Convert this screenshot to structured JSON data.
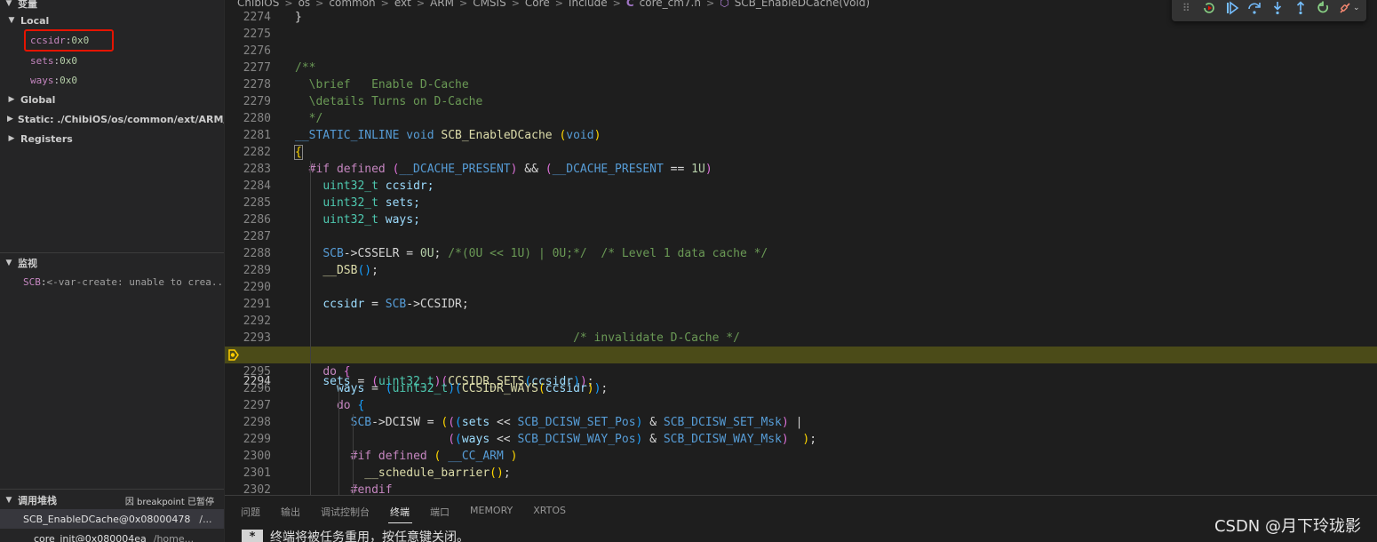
{
  "sidebar": {
    "variables_header": "变量",
    "local_label": "Local",
    "locals": [
      {
        "name": "ccsidr",
        "value": "0x0"
      },
      {
        "name": "sets",
        "value": "0x0"
      },
      {
        "name": "ways",
        "value": "0x0"
      }
    ],
    "scopes": [
      "Global",
      "Static: ./ChibiOS/os/common/ext/ARM/CMSIS",
      "Registers"
    ],
    "watch_header": "监视",
    "watch_items": [
      {
        "name": "SCB",
        "value": "<-var-create: unable to crea..."
      }
    ],
    "callstack_header": "调用堆栈",
    "callstack_status": "因 breakpoint 已暂停",
    "frames": [
      {
        "name": "SCB_EnableDCache@0x08000478",
        "path": "/..."
      },
      {
        "name": "core_init@0x080004ea",
        "path": "/home..."
      }
    ]
  },
  "breadcrumb": {
    "items": [
      "ChibiOS",
      "os",
      "common",
      "ext",
      "ARM",
      "CMSIS",
      "Core",
      "Include"
    ],
    "file": "core_cm7.h",
    "symbol": "SCB_EnableDCache(void)"
  },
  "debug_toolbar": {
    "buttons": [
      "drag-handle",
      "continue",
      "step-over",
      "step-into",
      "step-out",
      "restart",
      "disconnect"
    ]
  },
  "editor": {
    "current_line": 2294,
    "line_numbers": [
      2274,
      2275,
      2276,
      2277,
      2278,
      2279,
      2280,
      2281,
      2282,
      2283,
      2284,
      2285,
      2286,
      2287,
      2288,
      2289,
      2290,
      2291,
      2292,
      2293,
      2294,
      2295,
      2296,
      2297,
      2298,
      2299,
      2300,
      2301,
      2302
    ],
    "code": {
      "l2274": "}",
      "l2277": "/**",
      "l2278": "  \\brief   Enable D-Cache",
      "l2279": "  \\details Turns on D-Cache",
      "l2280": "  */",
      "l2281_a": "__STATIC_INLINE",
      "l2281_b": "void",
      "l2281_c": "SCB_EnableDCache",
      "l2281_d": "void",
      "l2283_a": "#if defined",
      "l2283_b": "__DCACHE_PRESENT",
      "l2283_c": "&&",
      "l2283_d": "__DCACHE_PRESENT",
      "l2283_e": "==",
      "l2283_f": "1U",
      "l2284_t": "uint32_t",
      "l2284_v": "ccsidr;",
      "l2285_t": "uint32_t",
      "l2285_v": "sets;",
      "l2286_t": "uint32_t",
      "l2286_v": "ways;",
      "l2288_a": "SCB",
      "l2288_b": "->CSSELR = ",
      "l2288_c": "0U",
      "l2288_d": "/*(0U << 1U) | 0U;*/",
      "l2288_e": "/* Level 1 data cache */",
      "l2289": "__DSB",
      "l2291_a": "ccsidr",
      "l2291_b": "SCB",
      "l2291_c": "->CCSIDR;",
      "l2293": "/* invalidate D-Cache */",
      "l2294_a": "sets",
      "l2294_b": "uint32_t",
      "l2294_c": "CCSIDR_SETS",
      "l2294_d": "ccsidr",
      "l2295": "do",
      "l2296_a": "ways",
      "l2296_b": "uint32_t",
      "l2296_c": "CCSIDR_WAYS",
      "l2296_d": "ccsidr",
      "l2297": "do",
      "l2298_a": "SCB",
      "l2298_b": "->DCISW",
      "l2298_c": "sets",
      "l2298_d": "SCB_DCISW_SET_Pos",
      "l2298_e": "SCB_DCISW_SET_Msk",
      "l2299_a": "ways",
      "l2299_b": "SCB_DCISW_WAY_Pos",
      "l2299_c": "SCB_DCISW_WAY_Msk",
      "l2300_a": "#if defined",
      "l2300_b": "__CC_ARM",
      "l2301": "__schedule_barrier",
      "l2302": "#endif"
    }
  },
  "panel": {
    "tabs": [
      "问题",
      "输出",
      "调试控制台",
      "终端",
      "端口",
      "MEMORY",
      "XRTOS"
    ],
    "active_tab": "终端",
    "terminal_marker": "*",
    "terminal_text": "终端将被任务重用，按任意键关闭。"
  },
  "watermark": "CSDN @月下玲珑影",
  "colors": {
    "highlight_box": "#e51400",
    "current_line_bg": "#4b4b18",
    "breakpoint": "#ffcc00"
  }
}
